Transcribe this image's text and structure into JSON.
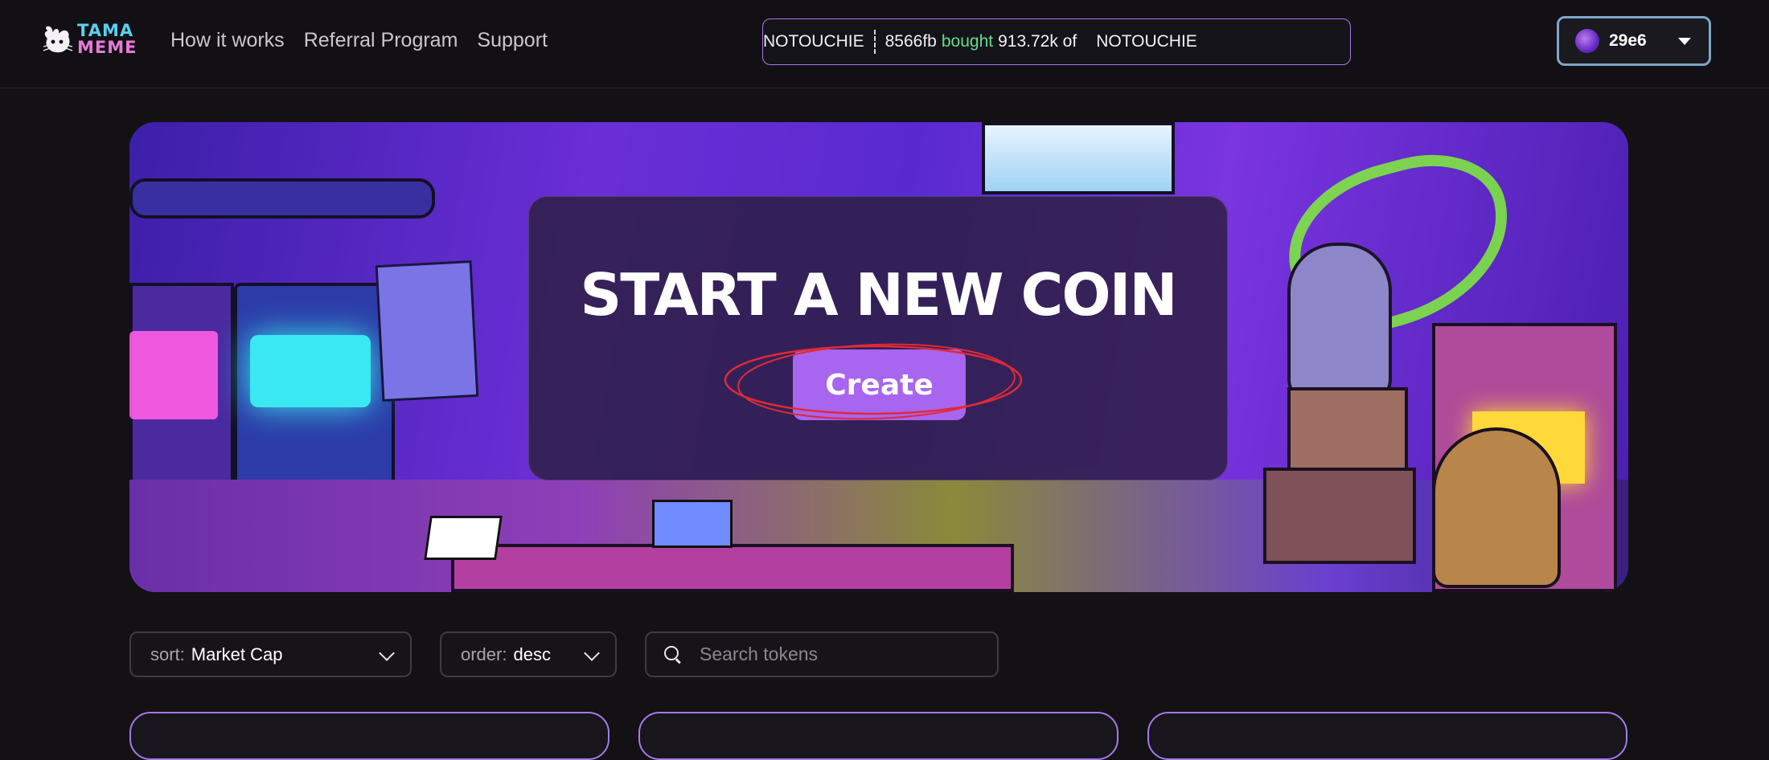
{
  "header": {
    "logo_text": [
      "TAMA",
      "MEME"
    ],
    "nav": [
      "How it works",
      "Referral Program",
      "Support"
    ],
    "ticker": {
      "token1": "NOTOUCHIE",
      "buyer": "8566fb",
      "action": "bought",
      "amount": "913.72k of",
      "token2": "NOTOUCHIE"
    },
    "wallet": {
      "address": "29e6",
      "icon": "wallet-avatar-icon"
    }
  },
  "hero": {
    "title": "START A NEW COIN",
    "create_label": "Create"
  },
  "filters": {
    "sort_label": "sort:",
    "sort_value": "Market Cap",
    "order_label": "order:",
    "order_value": "desc",
    "search_placeholder": "Search tokens"
  },
  "colors": {
    "accent": "#a865ef",
    "ticker_border": "#a67ae8",
    "bought_green": "#64dd8a",
    "annotation_red": "#e02a36"
  }
}
